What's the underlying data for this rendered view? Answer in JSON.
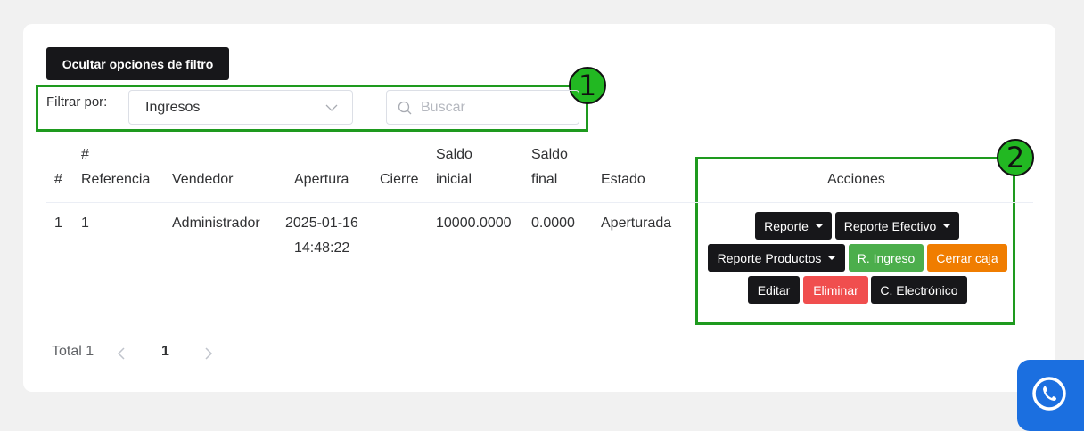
{
  "toolbar": {
    "toggle_filter_label": "Ocultar opciones de filtro"
  },
  "annotations": {
    "marker_1": "1",
    "marker_2": "2"
  },
  "filter": {
    "label": "Filtrar por:",
    "selected": "Ingresos",
    "search_placeholder": "Buscar"
  },
  "table": {
    "headers": {
      "num": "#",
      "ref_1": "#",
      "ref_2": "Referencia",
      "vendedor": "Vendedor",
      "apertura": "Apertura",
      "cierre": "Cierre",
      "saldo_inicial_1": "Saldo",
      "saldo_inicial_2": "inicial",
      "saldo_final_1": "Saldo",
      "saldo_final_2": "final",
      "estado": "Estado",
      "acciones": "Acciones"
    },
    "rows": [
      {
        "num": "1",
        "referencia": "1",
        "vendedor": "Administrador",
        "apertura_fecha": "2025-01-16",
        "apertura_hora": "14:48:22",
        "cierre": "",
        "saldo_inicial": "10000.0000",
        "saldo_final": "0.0000",
        "estado": "Aperturada"
      }
    ]
  },
  "actions": {
    "reporte": "Reporte",
    "reporte_efectivo": "Reporte Efectivo",
    "reporte_productos": "Reporte Productos",
    "r_ingreso": "R. Ingreso",
    "cerrar_caja": "Cerrar caja",
    "editar": "Editar",
    "eliminar": "Eliminar",
    "c_electronico": "C. Electrónico"
  },
  "pagination": {
    "total": "Total 1",
    "current_page": "1"
  },
  "colors": {
    "highlight": "#1e9a1e",
    "green_button": "#4cae4c",
    "orange_button": "#f07d00",
    "red_button": "#f04e4e",
    "dark_button": "#17171a"
  },
  "icons": {
    "search": "search-icon",
    "dropdown": "chevron-down-icon",
    "prev": "chevron-left-icon",
    "next": "chevron-right-icon",
    "whatsapp": "whatsapp-icon"
  }
}
